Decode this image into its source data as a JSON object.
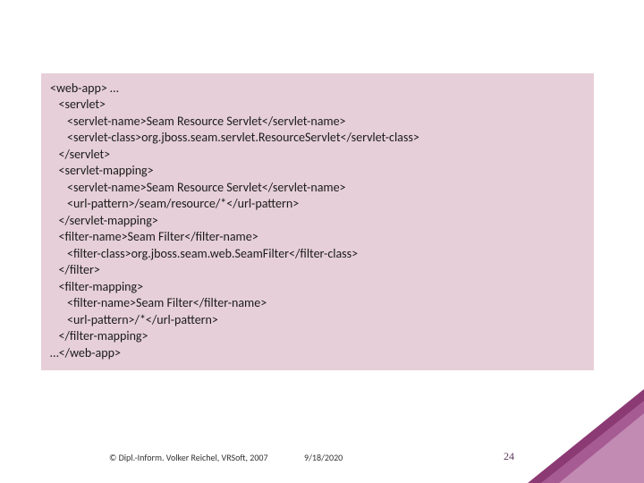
{
  "code": {
    "l01": "<web-app> …",
    "l02": "   <servlet>",
    "l03": "      <servlet-name>Seam Resource Servlet</servlet-name>",
    "l04": "      <servlet-class>org.jboss.seam.servlet.ResourceServlet</servlet-class>",
    "l05": "   </servlet>",
    "l06": "   <servlet-mapping>",
    "l07": "      <servlet-name>Seam Resource Servlet</servlet-name>",
    "l08": "      <url-pattern>/seam/resource/*</url-pattern>",
    "l09": "   </servlet-mapping>",
    "l10": "   <filter-name>Seam Filter</filter-name>",
    "l11": "      <filter-class>org.jboss.seam.web.SeamFilter</filter-class>",
    "l12": "   </filter>",
    "l13": "   <filter-mapping>",
    "l14": "      <filter-name>Seam Filter</filter-name>",
    "l15": "      <url-pattern>/*</url-pattern>",
    "l16": "   </filter-mapping>",
    "l17": "…</web-app>"
  },
  "footer": {
    "copyright": "© Dipl.-Inform. Volker Reichel, VRSoft, 2007",
    "date": "9/18/2020",
    "page": "24"
  }
}
